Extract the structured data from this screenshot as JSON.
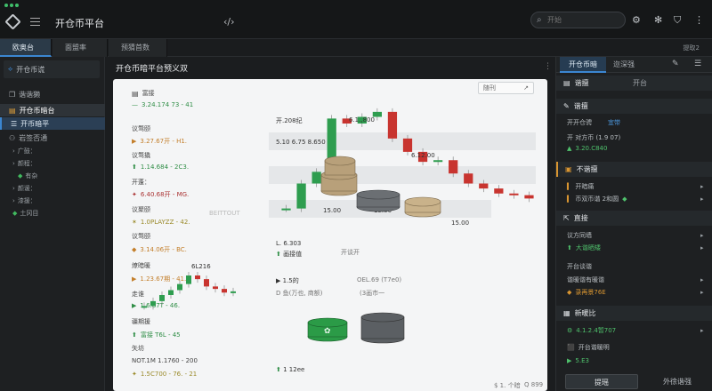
{
  "app": {
    "title": "开仓币平台",
    "search_placeholder": "开始"
  },
  "tabs": [
    {
      "label": "欧奥台"
    },
    {
      "label": "面盟率"
    },
    {
      "label": "预猜首数"
    }
  ],
  "tabs_right": "提取2",
  "sidebar": {
    "head": "开仓币谎",
    "items": [
      {
        "label": "谐谐獭"
      },
      {
        "label": "开仓币暗台"
      },
      {
        "label": "开币暗平"
      },
      {
        "label": "岩签否通"
      }
    ],
    "subs": [
      {
        "label": "广鼓："
      },
      {
        "label": "颜程："
      },
      {
        "label": "有杂"
      },
      {
        "label": "颜谖："
      },
      {
        "label": "漆援："
      },
      {
        "label": "土冈目"
      }
    ]
  },
  "main": {
    "title": "开仓币暗平台预义双",
    "box_label": "随刊",
    "list": [
      {
        "label": "富接",
        "value": "3.24.174 73 - 41"
      },
      {
        "label": "议骛颐",
        "value": "3.27.67开 - H1."
      },
      {
        "label": "议骛撬",
        "value": "1.14.684 - 2C3."
      },
      {
        "label": "开蓬：",
        "value": "6.40.68开 - MG."
      },
      {
        "label": "议聚颐",
        "value": "1.0PLAYZZ - 42."
      },
      {
        "label": "议骛颐",
        "value": "3.14.06开 - BC."
      },
      {
        "label": "燎暗暖",
        "value": "1.23.67期 - 41."
      },
      {
        "label": "走谁",
        "value": "1.6.87T - 46."
      },
      {
        "label": "疆期援",
        "value": "富接 T6L - 45"
      },
      {
        "label": "矢坊",
        "value": "NOT.1M 1.1760 - 200"
      },
      {
        "label": "",
        "value": "1.5C700 - 76. - 21"
      }
    ],
    "muted_label": "BEITTOUT",
    "chart2_label": "6L216",
    "scene": {
      "a": "开.208纪",
      "b": "6.1.,800",
      "c": "5.10 6.75 8.650",
      "d": "6.12.00",
      "e": "15.00",
      "f": "15.00",
      "g": "15.00",
      "h": "L. 6.303",
      "i": "画接值",
      "j": "开谈开",
      "k": "1.5的",
      "l": "OEL.69 (T7e0)",
      "m": "D 鱼(万也, 商额)",
      "n": "(3画市一",
      "o": "1 12ee",
      "p": "$ 1. 个暗",
      "q": "Q 899"
    }
  },
  "right": {
    "tabs": [
      {
        "label": "开仓币暗"
      },
      {
        "label": "迩深强"
      }
    ],
    "sec1": {
      "title": "谐擅",
      "aside": "开台"
    },
    "sec2": {
      "title": "谐擅"
    },
    "row_a": "开开仓骋",
    "row_a_aside": "宜带",
    "row_b": "开 对方币 (1.9 07)",
    "row_b_val": "3.20.C840",
    "sec3": {
      "title": "不谐擅"
    },
    "row_c": "开暗痛",
    "row_d": "币双币谐 2和圆",
    "sec4": {
      "title": "直接"
    },
    "row_e": "议方同墙",
    "row_f": "大谐晒矮",
    "row_g": "开台谈谐",
    "row_h": "谐暖谐有暖谐",
    "row_i": "录再景76E",
    "sec5": {
      "title": "新暖比"
    },
    "row_j": "4.1.2.4暂707",
    "row_k": "开台谐暖明",
    "row_l": "5.E3",
    "btn_primary": "提瑶",
    "btn_secondary": "外徐谐强"
  },
  "colors": {
    "accent": "#3b86d1",
    "up": "#2e9d4f",
    "down": "#c8342f",
    "panel": "#1e2022"
  },
  "chart_data": [
    {
      "type": "line",
      "title": "",
      "series": [
        {
          "values": [
            43,
            58,
            65,
            97,
            94,
            98,
            101,
            85,
            77,
            71,
            72,
            64,
            58,
            55,
            52,
            51,
            49
          ]
        }
      ]
    },
    {
      "type": "line",
      "title": "",
      "series": [
        {
          "values": [
            22,
            26,
            31,
            35,
            40,
            47,
            44,
            38,
            36,
            33,
            34
          ]
        }
      ]
    }
  ]
}
